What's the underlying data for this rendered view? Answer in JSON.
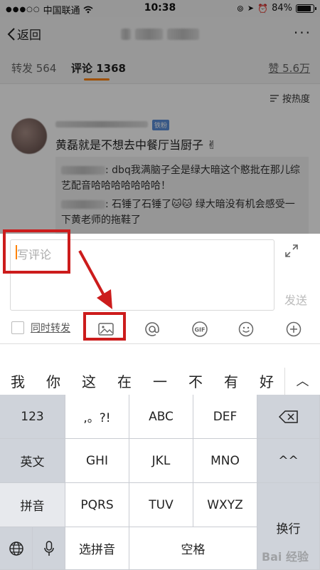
{
  "status_bar": {
    "carrier": "中国联通",
    "time": "10:38",
    "battery_percent": "84%",
    "battery_level": 0.84
  },
  "nav": {
    "back_label": "返回",
    "more_label": "···"
  },
  "tabs": {
    "repost": "转发 564",
    "comments": "评论 1368",
    "likes": "赞 5.6万"
  },
  "sort_label": "按热度",
  "comment": {
    "badge": "铁粉",
    "text": "黄磊就是不想去中餐厅当厨子 ✌",
    "replies": [
      {
        "text": ": dbq我满脑子全是绿大暗这个憨批在那儿综艺配音哈哈哈哈哈哈哈！"
      },
      {
        "text": ": 石锤了石锤了🐱🐱 绿大暗没有机会感受一下黄老师的拖鞋了"
      }
    ]
  },
  "compose": {
    "placeholder": "写评论",
    "send_label": "发送",
    "repost_label": "同时转发",
    "tools": [
      "image-icon",
      "at-icon",
      "gif-icon",
      "emoji-icon",
      "plus-icon"
    ]
  },
  "candidates": [
    "我",
    "你",
    "这",
    "在",
    "一",
    "不",
    "有",
    "好"
  ],
  "keyboard": {
    "left_col": [
      "123",
      "英文",
      "拼音"
    ],
    "row1": [
      ",。?!",
      "ABC",
      "DEF"
    ],
    "row2": [
      "GHI",
      "JKL",
      "MNO"
    ],
    "row3": [
      "PQRS",
      "TUV",
      "WXYZ"
    ],
    "emoticon": "^^",
    "return_label": "换行",
    "select_pinyin": "选拼音",
    "space_label": "空格"
  },
  "watermark": "Bai 经验"
}
